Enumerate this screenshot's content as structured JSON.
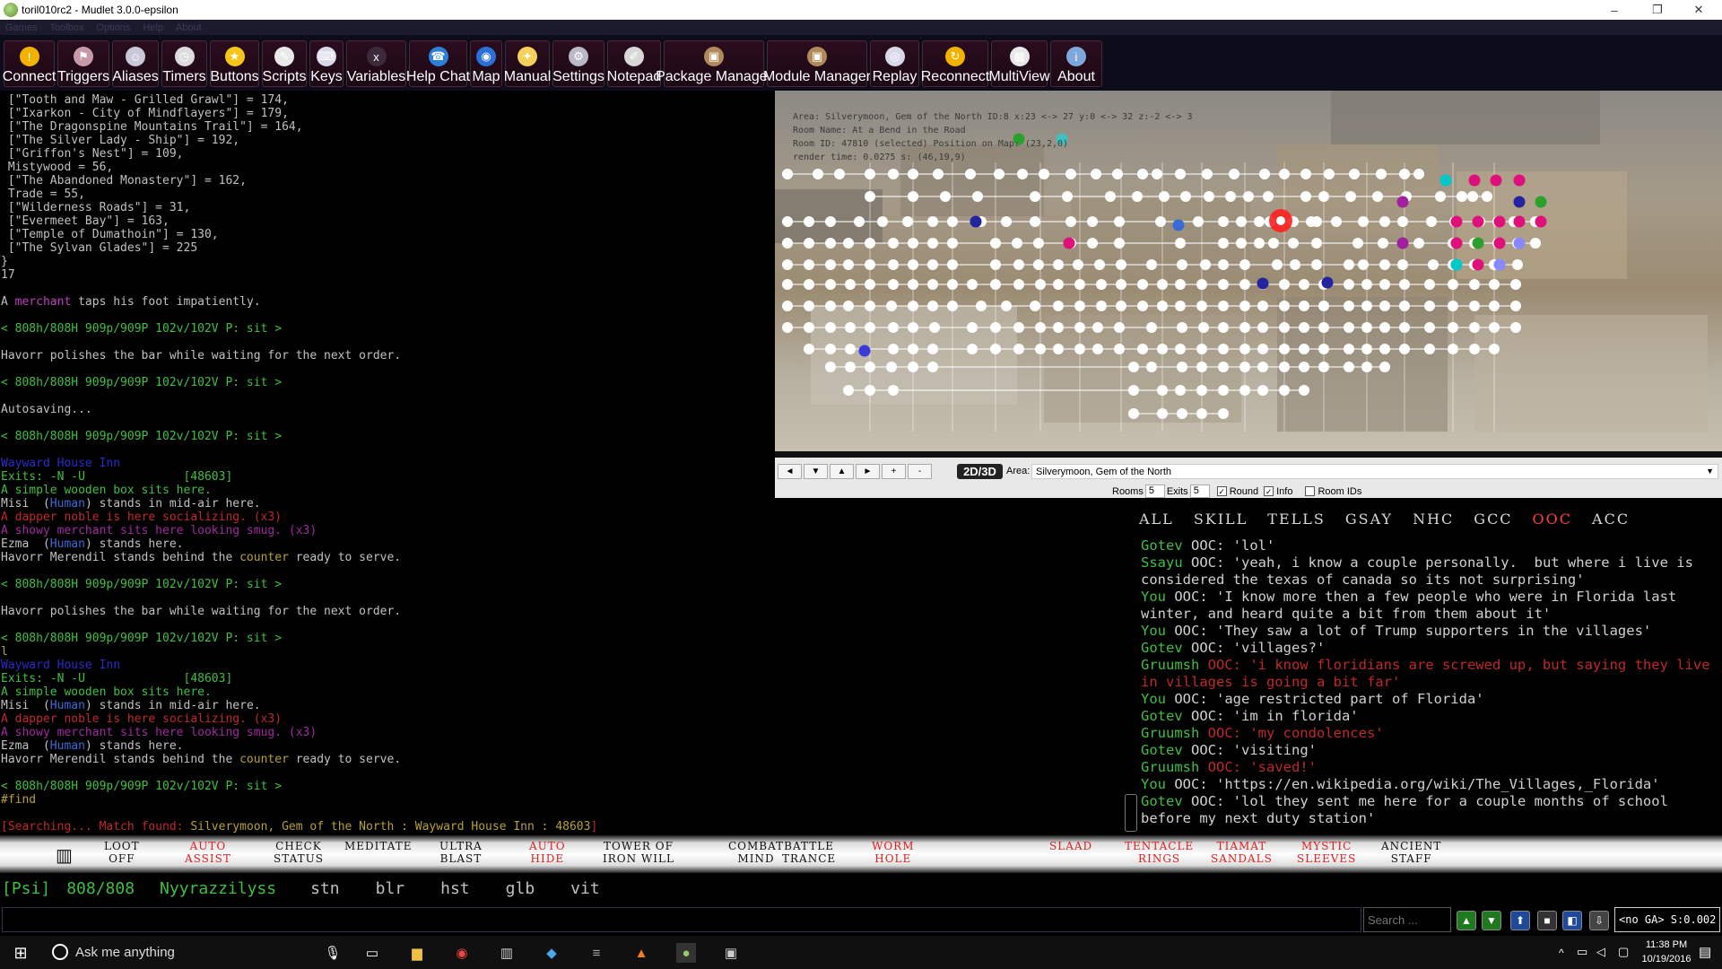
{
  "window": {
    "title": "toril010rc2 - Mudlet 3.0.0-epsilon",
    "minimize": "–",
    "restore": "❐",
    "close": "✕"
  },
  "menu": [
    "Games",
    "Toolbox",
    "Options",
    "Help",
    "About"
  ],
  "toolbar": [
    {
      "label": "Connect",
      "icon": "connect-icon",
      "color": "#f2b300",
      "glyph": "!"
    },
    {
      "label": "Triggers",
      "icon": "triggers-icon",
      "color": "#c79aa8",
      "glyph": "⚑"
    },
    {
      "label": "Aliases",
      "icon": "aliases-icon",
      "color": "#c8c8d8",
      "glyph": "☺"
    },
    {
      "label": "Timers",
      "icon": "timers-icon",
      "color": "#dcdcdc",
      "glyph": "◷"
    },
    {
      "label": "Buttons",
      "icon": "buttons-icon",
      "color": "#f5c518",
      "glyph": "★"
    },
    {
      "label": "Scripts",
      "icon": "scripts-icon",
      "color": "#e8e8e8",
      "glyph": "✎"
    },
    {
      "label": "Keys",
      "icon": "keys-icon",
      "color": "#d8d8e8",
      "glyph": "⌨"
    },
    {
      "label": "Variables",
      "icon": "variables-icon",
      "color": "#3a2a3a",
      "glyph": "x"
    },
    {
      "label": "Help Chat",
      "icon": "help-chat-icon",
      "color": "#2b7fd8",
      "glyph": "☎"
    },
    {
      "label": "Map",
      "icon": "map-icon",
      "color": "#2b6fd8",
      "glyph": "◉"
    },
    {
      "label": "Manual",
      "icon": "manual-icon",
      "color": "#f5d05a",
      "glyph": "✦"
    },
    {
      "label": "Settings",
      "icon": "settings-icon",
      "color": "#b8b8c8",
      "glyph": "⚙"
    },
    {
      "label": "Notepad",
      "icon": "notepad-icon",
      "color": "#d8d8d8",
      "glyph": "✐"
    },
    {
      "label": "Package Manager",
      "icon": "package-manager-icon",
      "color": "#b08a58",
      "glyph": "▣"
    },
    {
      "label": "Module Manager",
      "icon": "module-manager-icon",
      "color": "#b08a58",
      "glyph": "▣"
    },
    {
      "label": "Replay",
      "icon": "replay-icon",
      "color": "#d8d8e8",
      "glyph": "◎"
    },
    {
      "label": "Reconnect",
      "icon": "reconnect-icon",
      "color": "#f2b300",
      "glyph": "↻"
    },
    {
      "label": "MultiView",
      "icon": "multiview-icon",
      "color": "#e8e8e8",
      "glyph": "▦"
    },
    {
      "label": "About",
      "icon": "about-icon",
      "color": "#7ea8d8",
      "glyph": "i"
    }
  ],
  "console": [
    [
      {
        "t": " [\"Tooth and Maw - Grilled Grawl\"] = 174,",
        "c": "#c0c0c0"
      }
    ],
    [
      {
        "t": " [\"Ixarkon - City of Mindflayers\"] = 179,",
        "c": "#c0c0c0"
      }
    ],
    [
      {
        "t": " [\"The Dragonspine Mountains Trail\"] = 164,",
        "c": "#c0c0c0"
      }
    ],
    [
      {
        "t": " [\"The Silver Lady - Ship\"] = 192,",
        "c": "#c0c0c0"
      }
    ],
    [
      {
        "t": " [\"Griffon's Nest\"] = 109,",
        "c": "#c0c0c0"
      }
    ],
    [
      {
        "t": " Mistywood = 56,",
        "c": "#c0c0c0"
      }
    ],
    [
      {
        "t": " [\"The Abandoned Monastery\"] = 162,",
        "c": "#c0c0c0"
      }
    ],
    [
      {
        "t": " Trade = 55,",
        "c": "#c0c0c0"
      }
    ],
    [
      {
        "t": " [\"Wilderness Roads\"] = 31,",
        "c": "#c0c0c0"
      }
    ],
    [
      {
        "t": " [\"Evermeet Bay\"] = 163,",
        "c": "#c0c0c0"
      }
    ],
    [
      {
        "t": " [\"Temple of Dumathoin\"] = 130,",
        "c": "#c0c0c0"
      }
    ],
    [
      {
        "t": " [\"The Sylvan Glades\"] = 225",
        "c": "#c0c0c0"
      }
    ],
    [
      {
        "t": "}",
        "c": "#c0c0c0"
      }
    ],
    [
      {
        "t": "17",
        "c": "#c0c0c0"
      }
    ],
    [
      {
        "t": "",
        "c": "#c0c0c0"
      }
    ],
    [
      {
        "t": "A ",
        "c": "#c0c0c0"
      },
      {
        "t": "merchant",
        "c": "#c040c0"
      },
      {
        "t": " taps his foot impatiently.",
        "c": "#c0c0c0"
      }
    ],
    [
      {
        "t": "",
        "c": "#c0c0c0"
      }
    ],
    [
      {
        "t": "< 808h/808H 909p/909P 102v/102V P: sit >",
        "c": "#3fbf3f"
      }
    ],
    [
      {
        "t": "",
        "c": "#c0c0c0"
      }
    ],
    [
      {
        "t": "Havorr polishes the bar while waiting for the next order.",
        "c": "#c0c0c0"
      }
    ],
    [
      {
        "t": "",
        "c": "#c0c0c0"
      }
    ],
    [
      {
        "t": "< 808h/808H 909p/909P 102v/102V P: sit >",
        "c": "#3fbf3f"
      }
    ],
    [
      {
        "t": "",
        "c": "#c0c0c0"
      }
    ],
    [
      {
        "t": "Autosaving...",
        "c": "#c0c0c0"
      }
    ],
    [
      {
        "t": "",
        "c": "#c0c0c0"
      }
    ],
    [
      {
        "t": "< 808h/808H 909p/909P 102v/102V P: sit >",
        "c": "#3fbf3f"
      }
    ],
    [
      {
        "t": "",
        "c": "#c0c0c0"
      }
    ],
    [
      {
        "t": "Wayward House Inn",
        "c": "#2a2ad0"
      }
    ],
    [
      {
        "t": "Exits: -N -U",
        "c": "#3fbf3f"
      },
      {
        "t": "              [48603]",
        "c": "#3fbf3f"
      }
    ],
    [
      {
        "t": "A simple wooden box sits here.",
        "c": "#3fbf3f"
      }
    ],
    [
      {
        "t": "Misi  (",
        "c": "#c0c0c0"
      },
      {
        "t": "Human",
        "c": "#3a6ad8"
      },
      {
        "t": ") stands in mid-air here.",
        "c": "#c0c0c0"
      }
    ],
    [
      {
        "t": "A dapper noble is here socializing. (x3)",
        "c": "#c02828"
      }
    ],
    [
      {
        "t": "A showy merchant sits here looking smug. (x3)",
        "c": "#a028a0"
      }
    ],
    [
      {
        "t": "Ezma  (",
        "c": "#c0c0c0"
      },
      {
        "t": "Human",
        "c": "#3a6ad8"
      },
      {
        "t": ") stands here.",
        "c": "#c0c0c0"
      }
    ],
    [
      {
        "t": "Havorr Merendil stands behind the ",
        "c": "#c0c0c0"
      },
      {
        "t": "counter",
        "c": "#b8a030"
      },
      {
        "t": " ready to serve.",
        "c": "#c0c0c0"
      }
    ],
    [
      {
        "t": "",
        "c": "#c0c0c0"
      }
    ],
    [
      {
        "t": "< 808h/808H 909p/909P 102v/102V P: sit >",
        "c": "#3fbf3f"
      }
    ],
    [
      {
        "t": "",
        "c": "#c0c0c0"
      }
    ],
    [
      {
        "t": "Havorr polishes the bar while waiting for the next order.",
        "c": "#c0c0c0"
      }
    ],
    [
      {
        "t": "",
        "c": "#c0c0c0"
      }
    ],
    [
      {
        "t": "< 808h/808H 909p/909P 102v/102V P: sit >",
        "c": "#3fbf3f"
      }
    ],
    [
      {
        "t": "l",
        "c": "#b8a030"
      }
    ],
    [
      {
        "t": "Wayward House Inn",
        "c": "#2a2ad0"
      }
    ],
    [
      {
        "t": "Exits: -N -U",
        "c": "#3fbf3f"
      },
      {
        "t": "              [48603]",
        "c": "#3fbf3f"
      }
    ],
    [
      {
        "t": "A simple wooden box sits here.",
        "c": "#3fbf3f"
      }
    ],
    [
      {
        "t": "Misi  (",
        "c": "#c0c0c0"
      },
      {
        "t": "Human",
        "c": "#3a6ad8"
      },
      {
        "t": ") stands in mid-air here.",
        "c": "#c0c0c0"
      }
    ],
    [
      {
        "t": "A dapper noble is here socializing. (x3)",
        "c": "#c02828"
      }
    ],
    [
      {
        "t": "A showy merchant sits here looking smug. (x3)",
        "c": "#a028a0"
      }
    ],
    [
      {
        "t": "Ezma  (",
        "c": "#c0c0c0"
      },
      {
        "t": "Human",
        "c": "#3a6ad8"
      },
      {
        "t": ") stands here.",
        "c": "#c0c0c0"
      }
    ],
    [
      {
        "t": "Havorr Merendil stands behind the ",
        "c": "#c0c0c0"
      },
      {
        "t": "counter",
        "c": "#b8a030"
      },
      {
        "t": " ready to serve.",
        "c": "#c0c0c0"
      }
    ],
    [
      {
        "t": "",
        "c": "#c0c0c0"
      }
    ],
    [
      {
        "t": "< 808h/808H 909p/909P 102v/102V P: sit >",
        "c": "#3fbf3f"
      }
    ],
    [
      {
        "t": "#find",
        "c": "#b8a030"
      }
    ],
    [
      {
        "t": "",
        "c": "#c0c0c0"
      }
    ],
    [
      {
        "t": "[Searching... Match found: ",
        "c": "#c02828"
      },
      {
        "t": "Silverymoon, Gem of the North : Wayward House Inn : 48603",
        "c": "#b8a030"
      },
      {
        "t": "]",
        "c": "#c02828"
      }
    ]
  ],
  "map": {
    "info": [
      "Area: Silverymoon, Gem of the North ID:8 x:23 <-> 27 y:0 <-> 32 z:-2 <-> 3",
      "Room Name: At a Bend in the Road",
      "Room ID: 47810 (selected) Position on Map: (23,2,0)",
      "render time: 0.0275 s: (46,19,9)"
    ],
    "area_label": "Area:",
    "area": "Silverymoon, Gem of the North",
    "toggle_2d3d": "2D/3D",
    "rooms_label": "Rooms",
    "rooms_value": "5",
    "exits_label": "Exits",
    "exits_value": "5",
    "round_label": "Round",
    "info_label": "Info",
    "roomids_label": "Room IDs",
    "nav": [
      "◄",
      "▼",
      "▲",
      "►",
      "+",
      "-"
    ],
    "dropdown_glyph": "▼"
  },
  "chat": {
    "tabs": [
      {
        "label": "ALL",
        "selected": false
      },
      {
        "label": "SKILL",
        "selected": false
      },
      {
        "label": "TELLS",
        "selected": false
      },
      {
        "label": "GSAY",
        "selected": false
      },
      {
        "label": "NHC",
        "selected": false
      },
      {
        "label": "GCC",
        "selected": false
      },
      {
        "label": "OOC",
        "selected": true
      },
      {
        "label": "ACC",
        "selected": false
      }
    ],
    "lines": [
      {
        "who": "Gotev",
        "msg": " OOC: 'lol'",
        "wc": "#3fbf3f",
        "mc": "#d0d0d0"
      },
      {
        "who": "Ssayu",
        "msg": " OOC: 'yeah, i know a couple personally.  but where i live is considered the texas of canada so its not surprising'",
        "wc": "#3fbf3f",
        "mc": "#d0d0d0"
      },
      {
        "who": "You",
        "msg": " OOC: 'I know more then a few people who were in Florida last winter, and heard quite a bit from them about it'",
        "wc": "#3fbf3f",
        "mc": "#d0d0d0"
      },
      {
        "who": "You",
        "msg": " OOC: 'They saw a lot of Trump supporters in the villages'",
        "wc": "#3fbf3f",
        "mc": "#d0d0d0"
      },
      {
        "who": "Gotev",
        "msg": " OOC: 'villages?'",
        "wc": "#3fbf3f",
        "mc": "#d0d0d0"
      },
      {
        "who": "Gruumsh",
        "msg": " OOC: 'i know floridians are screwed up, but saying they live in villages is going a bit far'",
        "wc": "#3fbf3f",
        "mc": "#c02828"
      },
      {
        "who": "You",
        "msg": " OOC: 'age restricted part of Florida'",
        "wc": "#3fbf3f",
        "mc": "#d0d0d0"
      },
      {
        "who": "Gotev",
        "msg": " OOC: 'im in florida'",
        "wc": "#3fbf3f",
        "mc": "#d0d0d0"
      },
      {
        "who": "Gruumsh",
        "msg": " OOC: 'my condolences'",
        "wc": "#3fbf3f",
        "mc": "#c02828"
      },
      {
        "who": "Gotev",
        "msg": " OOC: 'visiting'",
        "wc": "#3fbf3f",
        "mc": "#d0d0d0"
      },
      {
        "who": "Gruumsh",
        "msg": " OOC: 'saved!'",
        "wc": "#3fbf3f",
        "mc": "#c02828"
      },
      {
        "who": "You",
        "msg": " OOC: 'https://en.wikipedia.org/wiki/The_Villages,_Florida'",
        "wc": "#3fbf3f",
        "mc": "#d0d0d0"
      },
      {
        "who": "Gotev",
        "msg": " OOC: 'lol they sent me here for a couple months of school before my next duty station'",
        "wc": "#3fbf3f",
        "mc": "#d0d0d0"
      }
    ]
  },
  "skills": [
    {
      "l1": "LOOT",
      "l2": "OFF",
      "red": false
    },
    {
      "l1": "AUTO",
      "l2": "ASSIST",
      "red": true
    },
    {
      "l1": "CHECK",
      "l2": "STATUS",
      "red": false
    },
    {
      "l1": "MEDITATE",
      "l2": "",
      "red": false
    },
    {
      "l1": "ULTRA",
      "l2": "BLAST",
      "red": false
    },
    {
      "l1": "AUTO",
      "l2": "HIDE",
      "red": true
    },
    {
      "l1": "TOWER OF",
      "l2": "IRON WILL",
      "red": false
    },
    {
      "l1": "COMBAT",
      "l2": "MIND",
      "red": false
    },
    {
      "l1": "BATTLE",
      "l2": "TRANCE",
      "red": false
    },
    {
      "l1": "WORM",
      "l2": "HOLE",
      "red": true
    },
    {
      "l1": "SLAAD",
      "l2": "",
      "red": true
    },
    {
      "l1": "TENTACLE",
      "l2": "RINGS",
      "red": true
    },
    {
      "l1": "TIAMAT",
      "l2": "SANDALS",
      "red": true
    },
    {
      "l1": "MYSTIC",
      "l2": "SLEEVES",
      "red": true
    },
    {
      "l1": "ANCIENT",
      "l2": "STAFF",
      "red": false
    }
  ],
  "status": {
    "class": "[Psi]",
    "hp": "808/808",
    "name": "Nyyrazzilyss",
    "effects": [
      "stn",
      "blr",
      "hst",
      "glb",
      "vit"
    ]
  },
  "input": {
    "value": "",
    "search_placeholder": "Search ...",
    "lag": "<no GA> S:0.002"
  },
  "taskbar": {
    "search_placeholder": "Ask me anything",
    "time": "11:38 PM",
    "date": "10/19/2016"
  }
}
